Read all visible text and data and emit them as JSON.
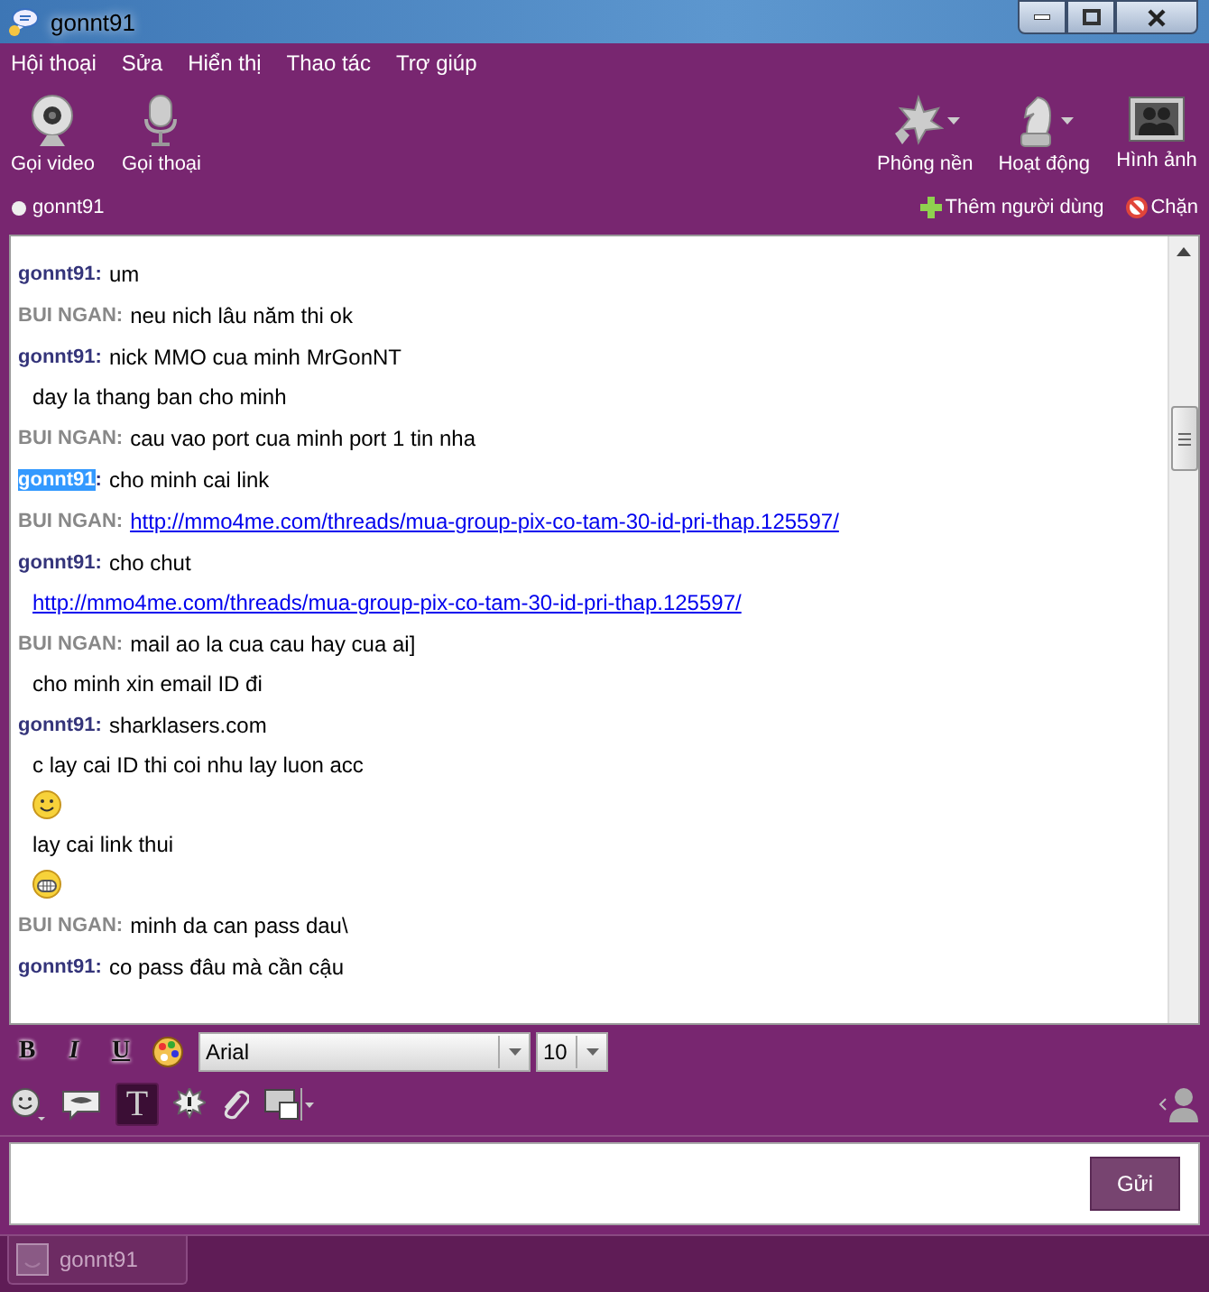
{
  "window": {
    "title": "gonnt91"
  },
  "menu": [
    "Hội thoại",
    "Sửa",
    "Hiển thị",
    "Thao tác",
    "Trợ giúp"
  ],
  "left_tools": [
    {
      "label": "Gọi video",
      "kind": "webcam"
    },
    {
      "label": "Gọi thoại",
      "kind": "mic"
    }
  ],
  "right_tools": [
    {
      "label": "Phông nền",
      "kind": "leaf",
      "dropdown": true
    },
    {
      "label": "Hoạt động",
      "kind": "chess",
      "dropdown": true
    },
    {
      "label": "Hình ảnh",
      "kind": "photos",
      "dropdown": false
    }
  ],
  "contact": {
    "name": "gonnt91"
  },
  "actions": [
    {
      "label": "Thêm người dùng",
      "kind": "add"
    },
    {
      "label": "Chặn",
      "kind": "block"
    }
  ],
  "messages": [
    {
      "sender": "gonnt91",
      "separator": ":",
      "kind": "me",
      "selected": false,
      "lines": [
        {
          "kind": "text",
          "text": "um"
        }
      ]
    },
    {
      "sender": "BUI NGAN",
      "separator": ":",
      "kind": "other",
      "selected": false,
      "lines": [
        {
          "kind": "text",
          "text": "neu nich lâu năm thi ok"
        }
      ]
    },
    {
      "sender": "gonnt91",
      "separator": ":",
      "kind": "me",
      "selected": false,
      "lines": [
        {
          "kind": "text",
          "text": "nick MMO cua minh MrGonNT"
        },
        {
          "kind": "text",
          "text": "day la thang ban cho minh"
        }
      ]
    },
    {
      "sender": "BUI NGAN",
      "separator": ":",
      "kind": "other",
      "selected": false,
      "lines": [
        {
          "kind": "text",
          "text": "cau vao port cua minh port 1 tin nha"
        }
      ]
    },
    {
      "sender": "gonnt91",
      "separator": ":",
      "kind": "me",
      "selected": true,
      "lines": [
        {
          "kind": "text",
          "text": "cho minh cai link"
        }
      ]
    },
    {
      "sender": "BUI NGAN",
      "separator": ":",
      "kind": "other",
      "selected": false,
      "lines": [
        {
          "kind": "link",
          "text": "http://mmo4me.com/threads/mua-group-pix-co-tam-30-id-pri-thap.125597/"
        }
      ]
    },
    {
      "sender": "gonnt91",
      "separator": ":",
      "kind": "me",
      "selected": false,
      "lines": [
        {
          "kind": "text",
          "text": "cho chut"
        },
        {
          "kind": "link",
          "text": "http://mmo4me.com/threads/mua-group-pix-co-tam-30-id-pri-thap.125597/"
        }
      ]
    },
    {
      "sender": "BUI NGAN",
      "separator": ":",
      "kind": "other",
      "selected": false,
      "lines": [
        {
          "kind": "text",
          "text": "mail ao la cua cau hay cua ai]"
        },
        {
          "kind": "text",
          "text": "cho minh xin email ID đi"
        }
      ]
    },
    {
      "sender": "gonnt91",
      "separator": ":",
      "kind": "me",
      "selected": false,
      "lines": [
        {
          "kind": "text",
          "text": "sharklasers.com"
        },
        {
          "kind": "text",
          "text": "c lay cai ID thi coi nhu lay luon acc"
        },
        {
          "kind": "smile"
        },
        {
          "kind": "text",
          "text": "lay cai link thui"
        },
        {
          "kind": "grin"
        }
      ]
    },
    {
      "sender": "BUI NGAN",
      "separator": ":",
      "kind": "other",
      "selected": false,
      "lines": [
        {
          "kind": "text",
          "text": "minh da can pass dau\\"
        }
      ]
    },
    {
      "sender": "gonnt91",
      "separator": ":",
      "kind": "me",
      "selected": false,
      "lines": [
        {
          "kind": "text",
          "text": "co pass đâu mà cần cậu"
        }
      ]
    }
  ],
  "format": {
    "buttons": [
      {
        "label": "B",
        "kind": "bold"
      },
      {
        "label": "I",
        "kind": "italic"
      },
      {
        "label": "U",
        "kind": "underline"
      }
    ],
    "font": "Arial",
    "size": "10"
  },
  "toolbar": {
    "text_style": {
      "label": "T",
      "selected": true
    }
  },
  "composer": {
    "send": "Gửi"
  },
  "tabs": [
    {
      "label": "gonnt91",
      "selected": true
    }
  ]
}
